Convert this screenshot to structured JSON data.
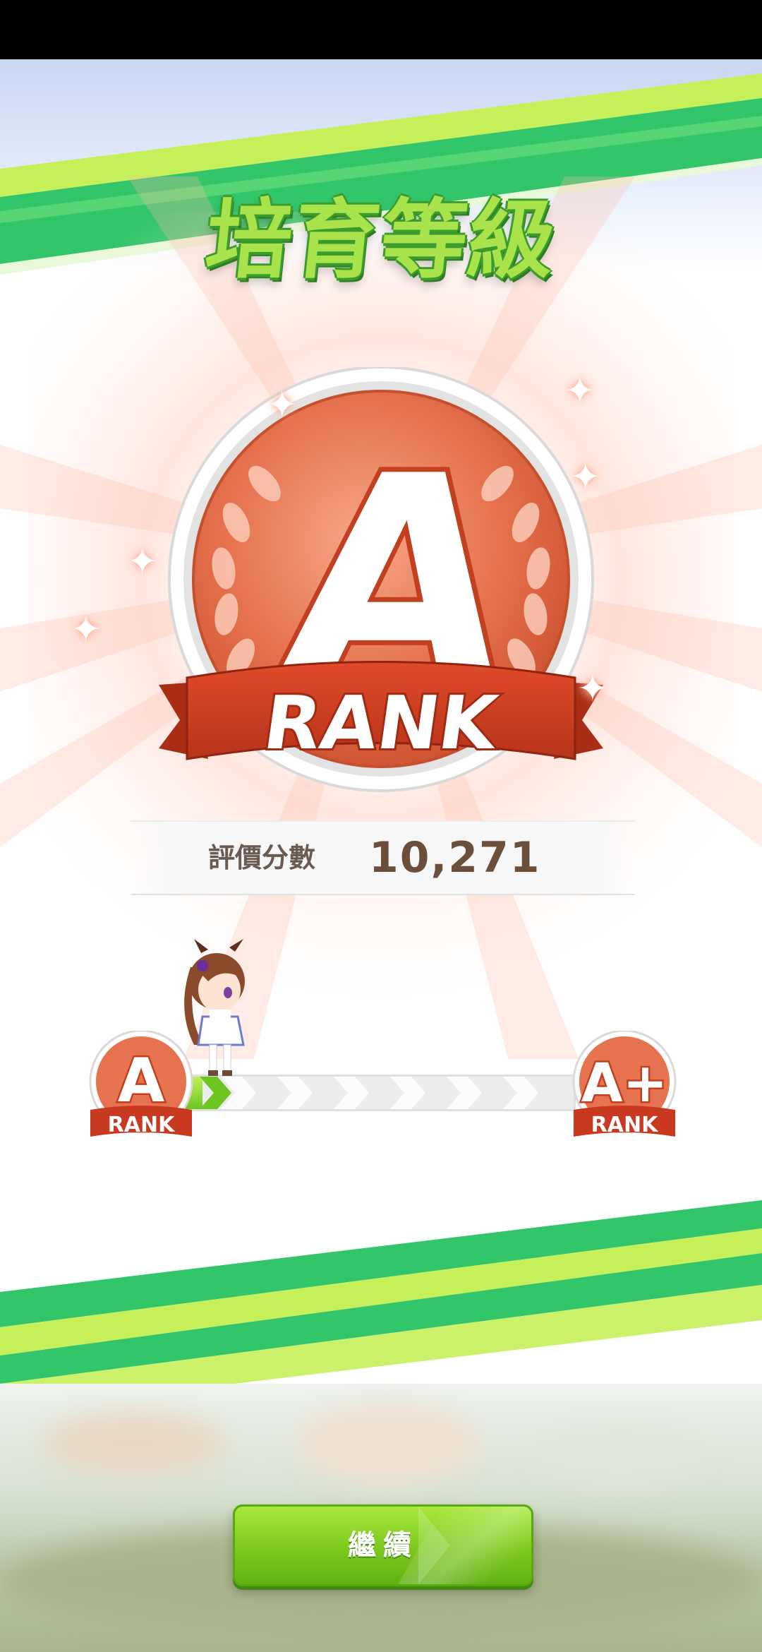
{
  "header": {
    "title": "培育等級"
  },
  "rank_medal": {
    "letter": "A",
    "ribbon_label": "RANK"
  },
  "score": {
    "label": "評價分數",
    "value": "10,271"
  },
  "progress": {
    "current_rank": {
      "letter": "A",
      "label": "RANK"
    },
    "next_rank": {
      "letter": "A+",
      "label": "RANK"
    },
    "fill_fraction": 0.06
  },
  "footer": {
    "continue_label": "繼續"
  },
  "colors": {
    "accent_green": "#7cc81e",
    "medal_orange": "#e2694a",
    "ribbon_red": "#c8391f",
    "title_green": "#a9e34b"
  }
}
